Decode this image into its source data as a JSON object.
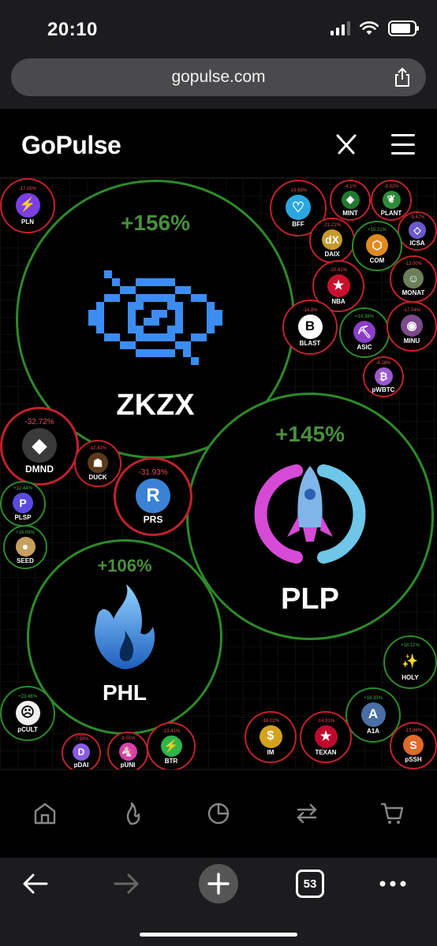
{
  "status_bar": {
    "time": "20:10"
  },
  "browser": {
    "url": "gopulse.com",
    "tab_count": "53"
  },
  "app": {
    "logo": "GoPulse"
  },
  "big_bubbles": [
    {
      "symbol": "ZKZX",
      "change": "+156%",
      "direction": "up"
    },
    {
      "symbol": "PLP",
      "change": "+145%",
      "direction": "up"
    },
    {
      "symbol": "PHL",
      "change": "+106%",
      "direction": "up"
    }
  ],
  "bubbles": [
    {
      "symbol": "PLN",
      "change": "-17.05%",
      "direction": "down",
      "icon_color": "#7b3fe4",
      "glyph": "⚡"
    },
    {
      "symbol": "BFF",
      "change": "-19.88%",
      "direction": "down",
      "icon_color": "#2aa7e0",
      "glyph": "♡"
    },
    {
      "symbol": "MINT",
      "change": "-4.1%",
      "direction": "down",
      "icon_color": "#1f7a2f",
      "glyph": "◆"
    },
    {
      "symbol": "PLANT",
      "change": "-9.92%",
      "direction": "down",
      "icon_color": "#2e8b3a",
      "glyph": "❦"
    },
    {
      "symbol": "ICSA",
      "change": "-5.47%",
      "direction": "down",
      "icon_color": "#6a5acd",
      "glyph": "◇"
    },
    {
      "symbol": "DAIX",
      "change": "-21.22%",
      "direction": "down",
      "icon_color": "#c49a2c",
      "glyph": "dX"
    },
    {
      "symbol": "COM",
      "change": "+15.21%",
      "direction": "up",
      "icon_color": "#e08a1e",
      "glyph": "⬡"
    },
    {
      "symbol": "MONAT",
      "change": "-13.00%",
      "direction": "down",
      "icon_color": "#6b7f5a",
      "glyph": "☺"
    },
    {
      "symbol": "NBA",
      "change": "-20.81%",
      "direction": "down",
      "icon_color": "#c8102e",
      "glyph": "★"
    },
    {
      "symbol": "BLAST",
      "change": "-14.8%",
      "direction": "down",
      "icon_color": "#ffffff",
      "glyph": "B"
    },
    {
      "symbol": "ASIC",
      "change": "+14.38%",
      "direction": "up",
      "icon_color": "#8a3ec8",
      "glyph": "⛏"
    },
    {
      "symbol": "MINU",
      "change": "-17.04%",
      "direction": "down",
      "icon_color": "#7a4a8a",
      "glyph": "◉"
    },
    {
      "symbol": "pWBTC",
      "change": "-6.26%",
      "direction": "down",
      "icon_color": "#9b59d0",
      "glyph": "₿"
    },
    {
      "symbol": "DMND",
      "change": "-32.72%",
      "direction": "down",
      "icon_color": "#3a3a3a",
      "glyph": "◆"
    },
    {
      "symbol": "DUCK",
      "change": "-12.81%",
      "direction": "down",
      "icon_color": "#5a3a1a",
      "glyph": "☗"
    },
    {
      "symbol": "PRS",
      "change": "-31.93%",
      "direction": "down",
      "icon_color": "#3b82d6",
      "glyph": "R"
    },
    {
      "symbol": "PLSP",
      "change": "+12.44%",
      "direction": "up",
      "icon_color": "#5a4ae0",
      "glyph": "P"
    },
    {
      "symbol": "SEED",
      "change": "+16.09%",
      "direction": "up",
      "icon_color": "#c8a060",
      "glyph": "●"
    },
    {
      "symbol": "HOLY",
      "change": "+18.12%",
      "direction": "up",
      "icon_color": "#000000",
      "glyph": "✨"
    },
    {
      "symbol": "pCULT",
      "change": "+23.46%",
      "direction": "up",
      "icon_color": "#f0f0f0",
      "glyph": "☹"
    },
    {
      "symbol": "A1A",
      "change": "+18.33%",
      "direction": "up",
      "icon_color": "#4a6fa5",
      "glyph": "A"
    },
    {
      "symbol": "IM",
      "change": "-16.02%",
      "direction": "down",
      "icon_color": "#d4a21e",
      "glyph": "$"
    },
    {
      "symbol": "TEXAN",
      "change": "-14.91%",
      "direction": "down",
      "icon_color": "#bf0a30",
      "glyph": "★"
    },
    {
      "symbol": "pSSH",
      "change": "-13.88%",
      "direction": "down",
      "icon_color": "#e06a2a",
      "glyph": "S"
    },
    {
      "symbol": "pDAI",
      "change": "-7.90%",
      "direction": "down",
      "icon_color": "#8a5ae0",
      "glyph": "D"
    },
    {
      "symbol": "pUNI",
      "change": "-9.01%",
      "direction": "down",
      "icon_color": "#d63fa8",
      "glyph": "🦄"
    },
    {
      "symbol": "BTR",
      "change": "-13.41%",
      "direction": "down",
      "icon_color": "#2fb54a",
      "glyph": "⚡"
    }
  ],
  "nav": [
    "home-icon",
    "flame-icon",
    "pie-chart-icon",
    "swap-icon",
    "cart-icon"
  ],
  "toolbar": [
    "back-arrow-icon",
    "forward-arrow-icon",
    "new-tab-icon",
    "tabs-icon",
    "more-icon"
  ]
}
